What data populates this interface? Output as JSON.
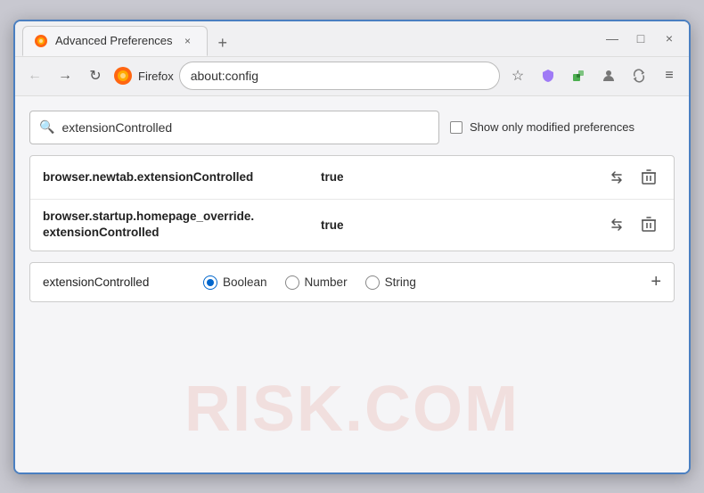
{
  "window": {
    "title": "Advanced Preferences",
    "close_label": "×",
    "minimize_label": "—",
    "maximize_label": "□",
    "new_tab_label": "+"
  },
  "nav": {
    "back_label": "←",
    "forward_label": "→",
    "reload_label": "↻",
    "firefox_label": "Firefox",
    "address": "about:config",
    "bookmark_icon": "☆",
    "shield_icon": "🛡",
    "extension_icon": "🧩",
    "sync_icon": "☁",
    "rotate_icon": "⟳",
    "menu_icon": "≡"
  },
  "search": {
    "placeholder": "extensionControlled",
    "value": "extensionControlled",
    "show_modified_label": "Show only modified preferences"
  },
  "results": [
    {
      "name": "browser.newtab.extensionControlled",
      "value": "true"
    },
    {
      "name_line1": "browser.startup.homepage_override.",
      "name_line2": "extensionControlled",
      "value": "true"
    }
  ],
  "new_pref": {
    "name": "extensionControlled",
    "types": [
      {
        "label": "Boolean",
        "selected": true
      },
      {
        "label": "Number",
        "selected": false
      },
      {
        "label": "String",
        "selected": false
      }
    ],
    "add_label": "+"
  },
  "watermark": "RISK.COM"
}
